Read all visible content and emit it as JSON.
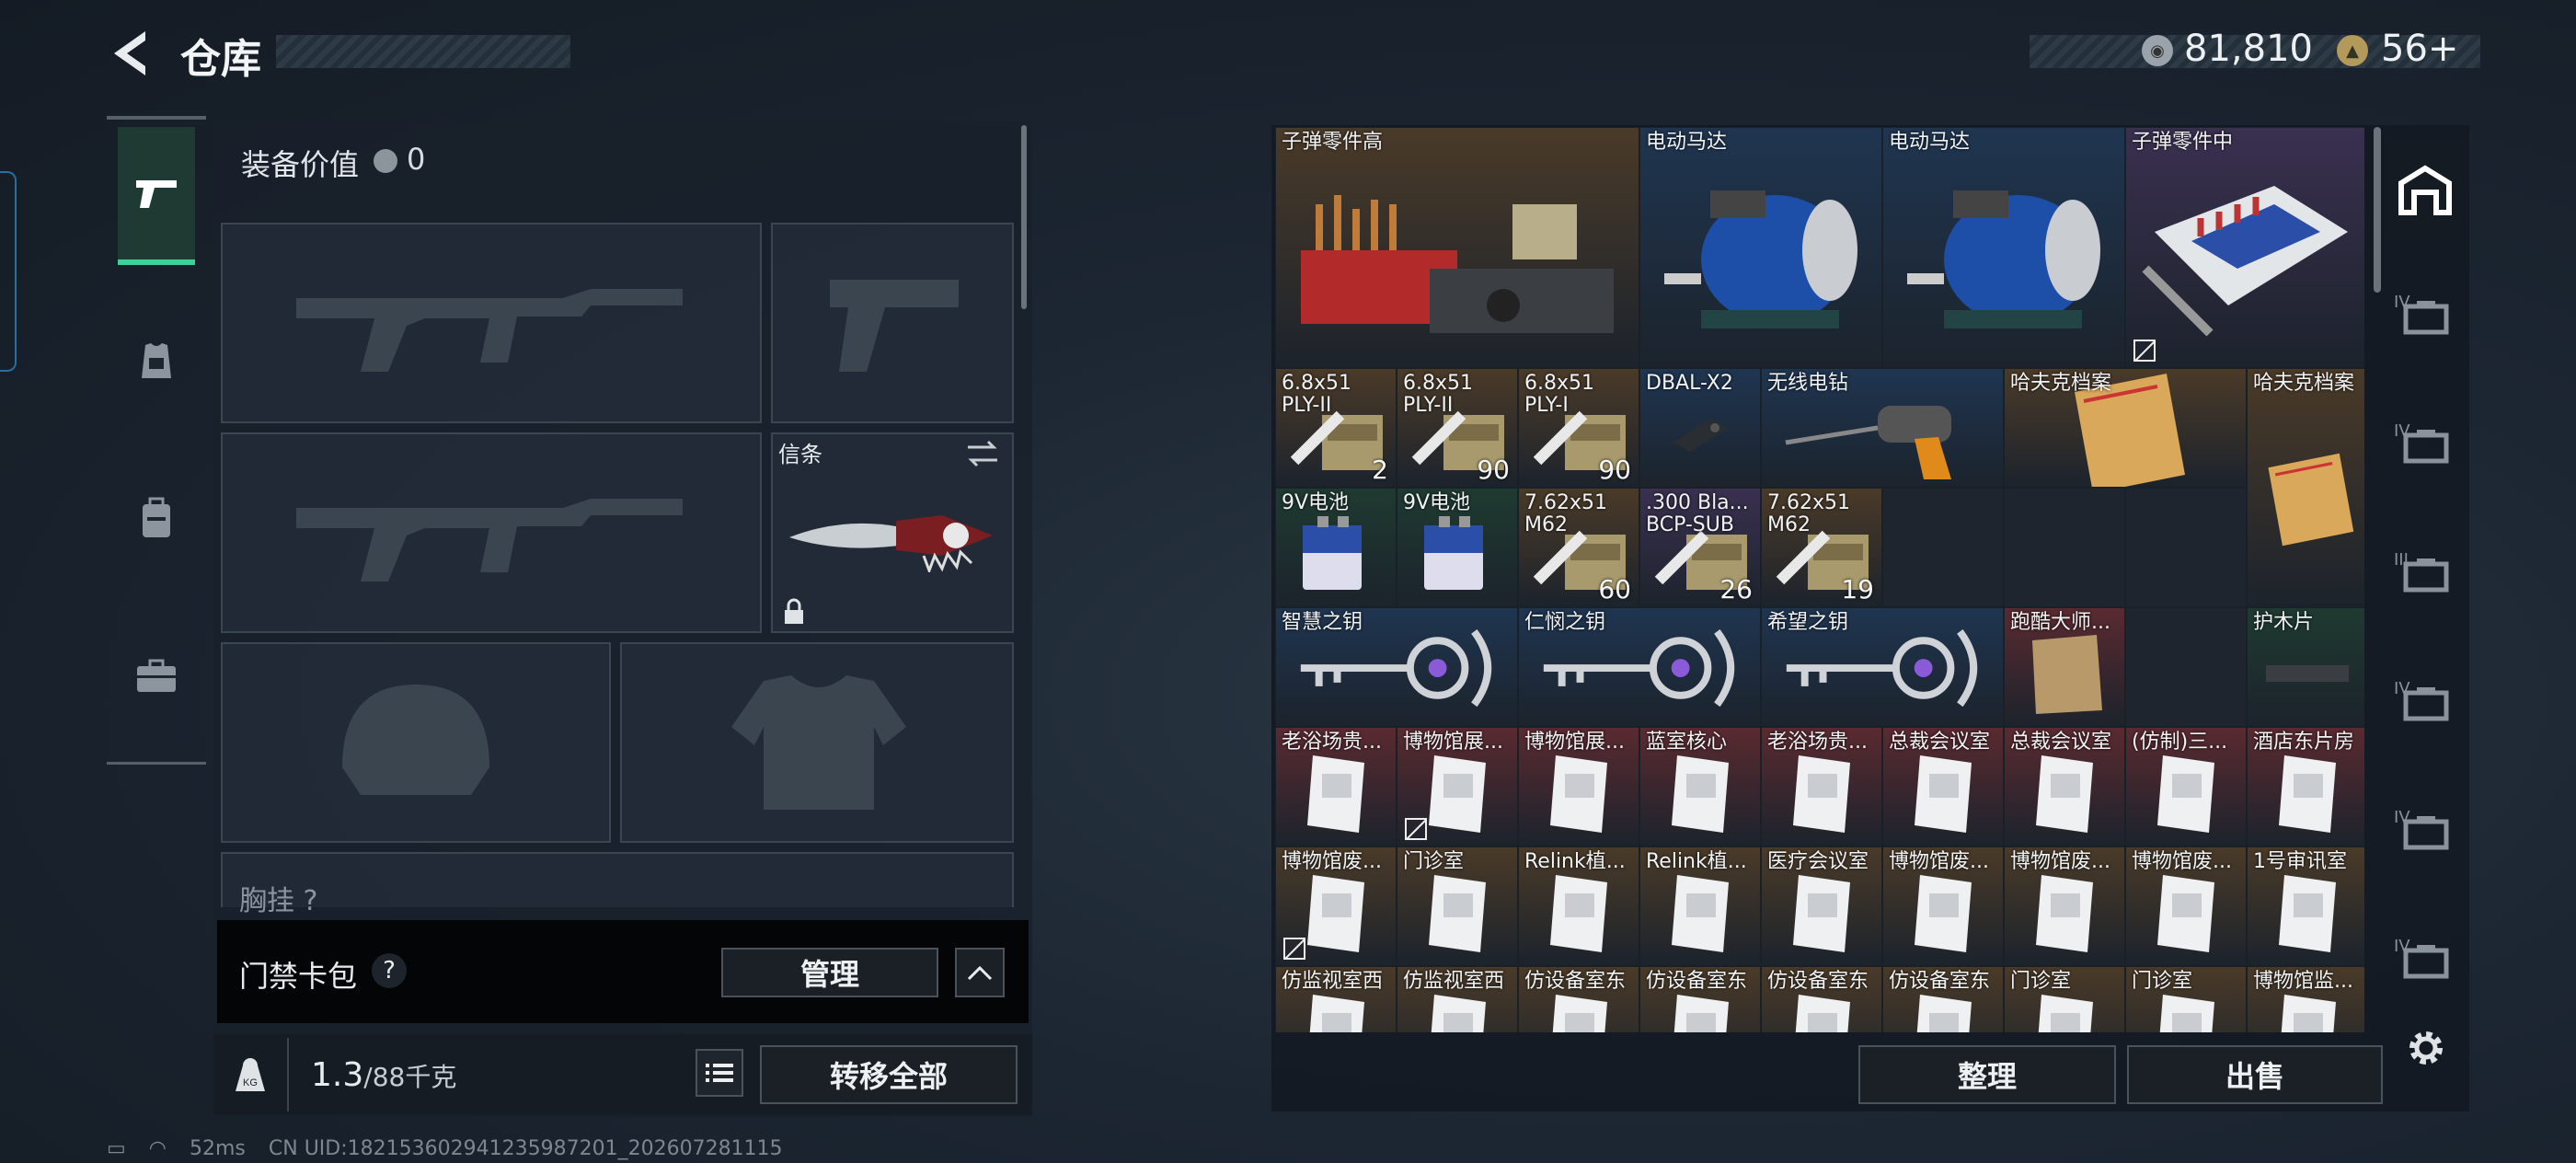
{
  "header": {
    "title": "仓库",
    "currency_main": "81,810",
    "currency_premium": "56+"
  },
  "equipment": {
    "value_label": "装备价值",
    "value_amount": "0",
    "knife_label": "信条",
    "chest_label": "胸挂 ?"
  },
  "keycard": {
    "label": "门禁卡包",
    "help": "?",
    "manage": "管理"
  },
  "weight": {
    "current": "1.3",
    "max": "/88千克",
    "transfer_all": "转移全部"
  },
  "status": {
    "ping": "52ms",
    "uid": "CN UID:18215360294123598720​1_202607281115"
  },
  "storage": {
    "sort_label": "整理",
    "sell_label": "出售",
    "items": [
      {
        "name": "子弹零件高",
        "count": "",
        "icon": "ammo-parts-crate"
      },
      {
        "name": "电动马达",
        "count": "",
        "icon": "electric-motor"
      },
      {
        "name": "电动马达",
        "count": "",
        "icon": "electric-motor"
      },
      {
        "name": "子弹零件中",
        "count": "",
        "icon": "ammo-parts-box"
      },
      {
        "name": "6.8x51\nPLY-II",
        "count": "2",
        "icon": "ammo-box"
      },
      {
        "name": "6.8x51\nPLY-II",
        "count": "90",
        "icon": "ammo-box"
      },
      {
        "name": "6.8x51\nPLY-I",
        "count": "90",
        "icon": "ammo-box"
      },
      {
        "name": "DBAL-X2",
        "count": "",
        "icon": "laser-module"
      },
      {
        "name": "无线电钻",
        "count": "",
        "icon": "cordless-drill"
      },
      {
        "name": "哈夫克档案",
        "count": "",
        "icon": "document-folder"
      },
      {
        "name": "哈夫克档案",
        "count": "",
        "icon": "document-folder"
      },
      {
        "name": "9V电池",
        "count": "",
        "icon": "battery"
      },
      {
        "name": "9V电池",
        "count": "",
        "icon": "battery"
      },
      {
        "name": "7.62x51\nM62",
        "count": "60",
        "icon": "ammo-box"
      },
      {
        "name": ".300 Bla...\nBCP-SUB",
        "count": "26",
        "icon": "ammo-box"
      },
      {
        "name": "7.62x51\nM62",
        "count": "19",
        "icon": "ammo-box"
      },
      {
        "name": "智慧之钥",
        "count": "",
        "icon": "ornate-key"
      },
      {
        "name": "仁悯之钥",
        "count": "",
        "icon": "ornate-key"
      },
      {
        "name": "希望之钥",
        "count": "",
        "icon": "ornate-key"
      },
      {
        "name": "跑酷大师...",
        "count": "",
        "icon": "parchment"
      },
      {
        "name": "护木片",
        "count": "",
        "icon": "handguard"
      },
      {
        "name": "老浴场贵...",
        "count": "",
        "icon": "keycard"
      },
      {
        "name": "博物馆展...",
        "count": "",
        "icon": "keycard"
      },
      {
        "name": "博物馆展...",
        "count": "",
        "icon": "keycard"
      },
      {
        "name": "蓝室核心",
        "count": "",
        "icon": "keycard"
      },
      {
        "name": "老浴场贵...",
        "count": "",
        "icon": "keycard"
      },
      {
        "name": "总裁会议室",
        "count": "",
        "icon": "keycard"
      },
      {
        "name": "总裁会议室",
        "count": "",
        "icon": "keycard"
      },
      {
        "name": "(仿制)三...",
        "count": "",
        "icon": "keycard"
      },
      {
        "name": "酒店东片房",
        "count": "",
        "icon": "keycard"
      },
      {
        "name": "博物馆废...",
        "count": "",
        "icon": "keycard"
      },
      {
        "name": "门诊室",
        "count": "",
        "icon": "keycard"
      },
      {
        "name": "Relink植...",
        "count": "",
        "icon": "keycard"
      },
      {
        "name": "Relink植...",
        "count": "",
        "icon": "keycard"
      },
      {
        "name": "医疗会议室",
        "count": "",
        "icon": "keycard"
      },
      {
        "name": "博物馆废...",
        "count": "",
        "icon": "keycard"
      },
      {
        "name": "博物馆废...",
        "count": "",
        "icon": "keycard"
      },
      {
        "name": "博物馆废...",
        "count": "",
        "icon": "keycard"
      },
      {
        "name": "1号审讯室",
        "count": "",
        "icon": "keycard"
      },
      {
        "name": "仿监视室西",
        "count": "",
        "icon": "keycard"
      },
      {
        "name": "仿监视室西",
        "count": "",
        "icon": "keycard"
      },
      {
        "name": "仿设备室东",
        "count": "",
        "icon": "keycard"
      },
      {
        "name": "仿设备室东",
        "count": "",
        "icon": "keycard"
      },
      {
        "name": "仿设备室东",
        "count": "",
        "icon": "keycard"
      },
      {
        "name": "仿设备室东",
        "count": "",
        "icon": "keycard"
      },
      {
        "name": "门诊室",
        "count": "",
        "icon": "keycard"
      },
      {
        "name": "门诊室",
        "count": "",
        "icon": "keycard"
      },
      {
        "name": "博物馆监...",
        "count": "",
        "icon": "keycard"
      }
    ]
  },
  "right_tabs": [
    "IV",
    "IV",
    "III",
    "IV",
    "IV",
    "IV"
  ],
  "colors": {
    "accent_green": "#3ad29a",
    "rarity_red": "#5a2a30",
    "rarity_purple": "#3a3050",
    "rarity_blue": "#1f3550",
    "rarity_gold": "#4a3a28",
    "rarity_green": "#1f3a30"
  }
}
